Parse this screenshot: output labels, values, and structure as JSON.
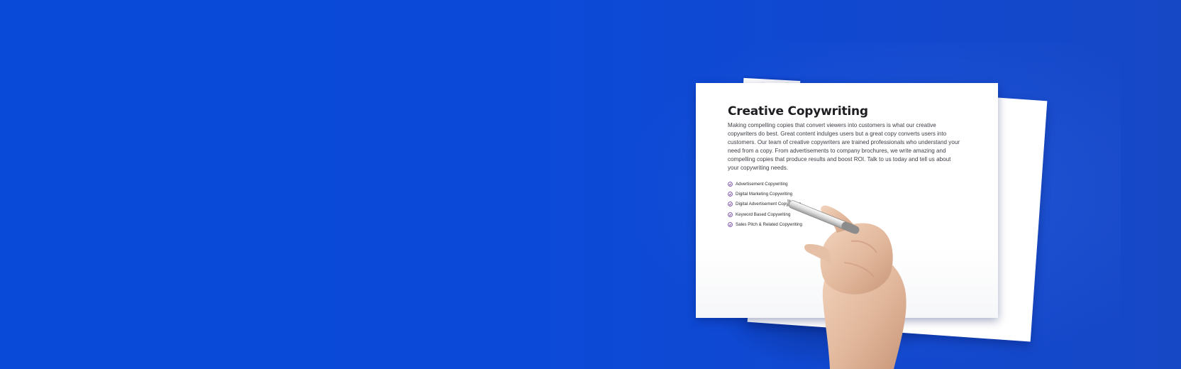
{
  "document": {
    "title": "Creative Copywriting",
    "body": "Making compelling copies that convert viewers into customers is what our creative copywriters do best. Great content indulges users but a great copy converts users into customers. Our team of creative copywriters are trained professionals who understand your need from a copy. From advertisements to company brochures, we write amazing and compelling copies that produce results and boost ROI. Talk to us today and tell us about your copywriting needs.",
    "services": [
      {
        "label": "Advertisement Copywriting",
        "icon": "check-circle-icon"
      },
      {
        "label": "Digital Marketing Copywriting",
        "icon": "check-circle-icon"
      },
      {
        "label": "Digital Advertisement Copywriting",
        "icon": "check-circle-icon"
      },
      {
        "label": "Keyword Based Copywriting",
        "icon": "check-circle-icon"
      },
      {
        "label": "Sales Pitch & Related Copywriting",
        "icon": "check-circle-icon"
      }
    ]
  },
  "colors": {
    "background": "#0b4ad8",
    "check_icon": "#6b3fa0",
    "title_text": "#1d1d22"
  }
}
